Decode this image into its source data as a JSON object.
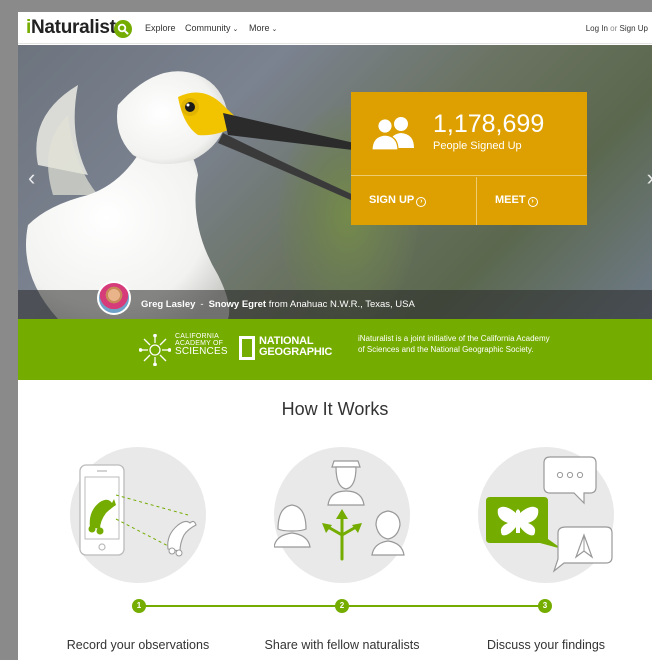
{
  "header": {
    "logo_prefix": "i",
    "logo_rest": "Naturalist",
    "search_icon": "search-icon",
    "nav": [
      {
        "label": "Explore",
        "has_caret": false
      },
      {
        "label": "Community",
        "has_caret": true
      },
      {
        "label": "More",
        "has_caret": true
      }
    ],
    "caret": "⌄",
    "login": "Log In",
    "or": "or",
    "signup": "Sign Up"
  },
  "hero": {
    "arrow_left": "‹",
    "arrow_right": "›",
    "stats": {
      "icon": "people-icon",
      "number": "1,178,699",
      "label": "People Signed Up",
      "signup_label": "SIGN UP",
      "meet_label": "MEET",
      "arrow_glyph": "›"
    },
    "caption": {
      "photographer": "Greg Lasley",
      "dash": "-",
      "species": "Snowy Egret",
      "location": "from Anahuac N.W.R., Texas, USA"
    }
  },
  "partners": {
    "cas_line1": "CALIFORNIA",
    "cas_line2": "ACADEMY OF",
    "cas_line3": "SCIENCES",
    "ng_line1": "NATIONAL",
    "ng_line2": "GEOGRAPHIC",
    "blurb": "iNaturalist is a joint initiative of the California Academy of Sciences and the National Geographic Society."
  },
  "how_it_works": {
    "title": "How It Works",
    "steps": [
      {
        "number": "1",
        "label": "Record your observations",
        "icon": "phone-caterpillar-icon"
      },
      {
        "number": "2",
        "label": "Share with fellow naturalists",
        "icon": "people-share-icon"
      },
      {
        "number": "3",
        "label": "Discuss your findings",
        "icon": "chat-butterfly-icon"
      }
    ]
  },
  "colors": {
    "brand_green": "#74ac00",
    "stats_gold": "#dea000"
  }
}
